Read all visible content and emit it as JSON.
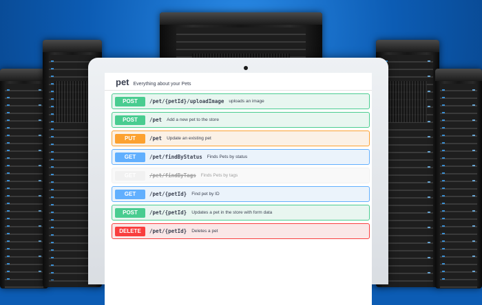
{
  "section": {
    "title": "pet",
    "description": "Everything about your Pets"
  },
  "operations": [
    {
      "method": "POST",
      "path": "/pet/{petId}/uploadImage",
      "summary": "uploads an image"
    },
    {
      "method": "POST",
      "path": "/pet",
      "summary": "Add a new pet to the store"
    },
    {
      "method": "PUT",
      "path": "/pet",
      "summary": "Update an existing pet"
    },
    {
      "method": "GET",
      "path": "/pet/findByStatus",
      "summary": "Finds Pets by status"
    },
    {
      "method": "GET",
      "path": "/pet/findByTags",
      "summary": "Finds Pets by tags",
      "deprecated": true
    },
    {
      "method": "GET",
      "path": "/pet/{petId}",
      "summary": "Find pet by ID"
    },
    {
      "method": "POST",
      "path": "/pet/{petId}",
      "summary": "Updates a pet in the store with form data"
    },
    {
      "method": "DELETE",
      "path": "/pet/{petId}",
      "summary": "Deletes a pet"
    }
  ],
  "colors": {
    "post": "#49cc90",
    "put": "#fca130",
    "get": "#61affe",
    "delete": "#f93e3e",
    "background": "#0c5cb4"
  },
  "icons": [
    "server-rack-icon",
    "laptop-camera-icon"
  ]
}
